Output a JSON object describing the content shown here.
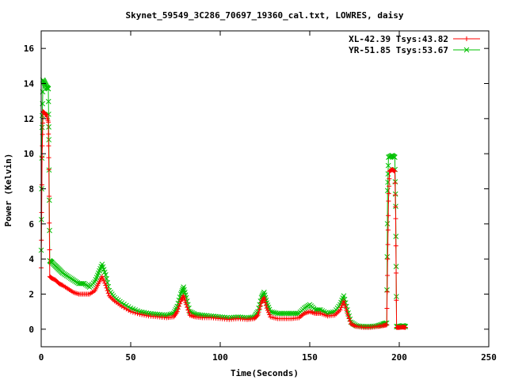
{
  "chart_data": {
    "type": "line",
    "title": "Skynet_59549_3C286_70697_19360_cal.txt, LOWRES, daisy",
    "xlabel": "Time(Seconds)",
    "ylabel": "Power (Kelvin)",
    "xlim": [
      0,
      250
    ],
    "ylim": [
      -1,
      17
    ],
    "x_ticks": [
      0,
      50,
      100,
      150,
      200,
      250
    ],
    "y_ticks": [
      0,
      2,
      4,
      6,
      8,
      10,
      12,
      14,
      16
    ],
    "grid": false,
    "legend_position": "top-right",
    "series": [
      {
        "name": "XL-42.39 Tsys:43.82",
        "color": "#ff0000",
        "marker": "plus",
        "points": [
          [
            0,
            3.5
          ],
          [
            0.5,
            9.8
          ],
          [
            1,
            12.4
          ],
          [
            2,
            12.3
          ],
          [
            3,
            12.2
          ],
          [
            4,
            11.8
          ],
          [
            4.3,
            9.1
          ],
          [
            4.8,
            3.0
          ],
          [
            6,
            2.9
          ],
          [
            8,
            2.8
          ],
          [
            10,
            2.6
          ],
          [
            12,
            2.5
          ],
          [
            15,
            2.3
          ],
          [
            18,
            2.1
          ],
          [
            21,
            2.0
          ],
          [
            24,
            2.0
          ],
          [
            27,
            2.0
          ],
          [
            30,
            2.2
          ],
          [
            32,
            2.6
          ],
          [
            34,
            3.0
          ],
          [
            36,
            2.5
          ],
          [
            38,
            1.9
          ],
          [
            41,
            1.6
          ],
          [
            45,
            1.3
          ],
          [
            50,
            1.0
          ],
          [
            55,
            0.85
          ],
          [
            60,
            0.75
          ],
          [
            65,
            0.7
          ],
          [
            70,
            0.65
          ],
          [
            74,
            0.7
          ],
          [
            76,
            1.0
          ],
          [
            78,
            1.6
          ],
          [
            79.5,
            1.9
          ],
          [
            81,
            1.4
          ],
          [
            83,
            0.8
          ],
          [
            86,
            0.7
          ],
          [
            90,
            0.65
          ],
          [
            95,
            0.65
          ],
          [
            100,
            0.6
          ],
          [
            105,
            0.55
          ],
          [
            110,
            0.6
          ],
          [
            115,
            0.55
          ],
          [
            119,
            0.6
          ],
          [
            121,
            0.8
          ],
          [
            123,
            1.5
          ],
          [
            124.5,
            1.8
          ],
          [
            126,
            1.2
          ],
          [
            128,
            0.7
          ],
          [
            132,
            0.6
          ],
          [
            136,
            0.6
          ],
          [
            140,
            0.6
          ],
          [
            144,
            0.65
          ],
          [
            147,
            0.9
          ],
          [
            150,
            1.0
          ],
          [
            153,
            0.9
          ],
          [
            156,
            0.9
          ],
          [
            160,
            0.75
          ],
          [
            164,
            0.8
          ],
          [
            167,
            1.1
          ],
          [
            169,
            1.6
          ],
          [
            171,
            0.9
          ],
          [
            173,
            0.3
          ],
          [
            176,
            0.15
          ],
          [
            180,
            0.1
          ],
          [
            184,
            0.1
          ],
          [
            188,
            0.15
          ],
          [
            191,
            0.2
          ],
          [
            193,
            0.25
          ],
          [
            193.5,
            4.0
          ],
          [
            194,
            7.3
          ],
          [
            194.5,
            9.0
          ],
          [
            196,
            9.1
          ],
          [
            197.5,
            9.0
          ],
          [
            198,
            6.3
          ],
          [
            198.5,
            0.1
          ],
          [
            200,
            0.1
          ],
          [
            202,
            0.12
          ],
          [
            203.5,
            0.1
          ]
        ]
      },
      {
        "name": "YR-51.85 Tsys:53.67",
        "color": "#00c000",
        "marker": "cross",
        "points": [
          [
            0,
            4.5
          ],
          [
            0.5,
            11.5
          ],
          [
            1,
            14.2
          ],
          [
            2,
            14.0
          ],
          [
            3,
            13.8
          ],
          [
            4,
            13.7
          ],
          [
            4.3,
            10.8
          ],
          [
            4.8,
            3.9
          ],
          [
            6,
            3.8
          ],
          [
            8,
            3.6
          ],
          [
            10,
            3.4
          ],
          [
            12,
            3.2
          ],
          [
            15,
            3.0
          ],
          [
            18,
            2.8
          ],
          [
            21,
            2.6
          ],
          [
            24,
            2.6
          ],
          [
            27,
            2.4
          ],
          [
            30,
            2.7
          ],
          [
            32,
            3.2
          ],
          [
            34,
            3.7
          ],
          [
            36,
            3.1
          ],
          [
            38,
            2.2
          ],
          [
            41,
            1.8
          ],
          [
            45,
            1.5
          ],
          [
            50,
            1.2
          ],
          [
            55,
            1.0
          ],
          [
            60,
            0.9
          ],
          [
            65,
            0.85
          ],
          [
            70,
            0.8
          ],
          [
            74,
            0.9
          ],
          [
            76,
            1.3
          ],
          [
            78,
            2.0
          ],
          [
            79.5,
            2.4
          ],
          [
            81,
            1.8
          ],
          [
            83,
            1.0
          ],
          [
            86,
            0.85
          ],
          [
            90,
            0.8
          ],
          [
            95,
            0.75
          ],
          [
            100,
            0.7
          ],
          [
            105,
            0.65
          ],
          [
            110,
            0.7
          ],
          [
            115,
            0.65
          ],
          [
            119,
            0.7
          ],
          [
            121,
            1.0
          ],
          [
            123,
            1.8
          ],
          [
            124.5,
            2.1
          ],
          [
            126,
            1.5
          ],
          [
            128,
            1.0
          ],
          [
            132,
            0.9
          ],
          [
            136,
            0.9
          ],
          [
            140,
            0.9
          ],
          [
            144,
            0.9
          ],
          [
            147,
            1.2
          ],
          [
            150,
            1.4
          ],
          [
            153,
            1.1
          ],
          [
            156,
            1.1
          ],
          [
            160,
            0.9
          ],
          [
            164,
            1.0
          ],
          [
            167,
            1.4
          ],
          [
            169,
            1.9
          ],
          [
            171,
            1.1
          ],
          [
            173,
            0.4
          ],
          [
            176,
            0.2
          ],
          [
            180,
            0.15
          ],
          [
            184,
            0.15
          ],
          [
            188,
            0.2
          ],
          [
            191,
            0.3
          ],
          [
            193,
            0.35
          ],
          [
            193.5,
            7.9
          ],
          [
            194,
            9.8
          ],
          [
            196,
            9.9
          ],
          [
            197.5,
            9.8
          ],
          [
            198,
            7.0
          ],
          [
            198.5,
            0.15
          ],
          [
            200,
            0.15
          ],
          [
            202,
            0.2
          ],
          [
            203.5,
            0.15
          ]
        ]
      }
    ]
  }
}
